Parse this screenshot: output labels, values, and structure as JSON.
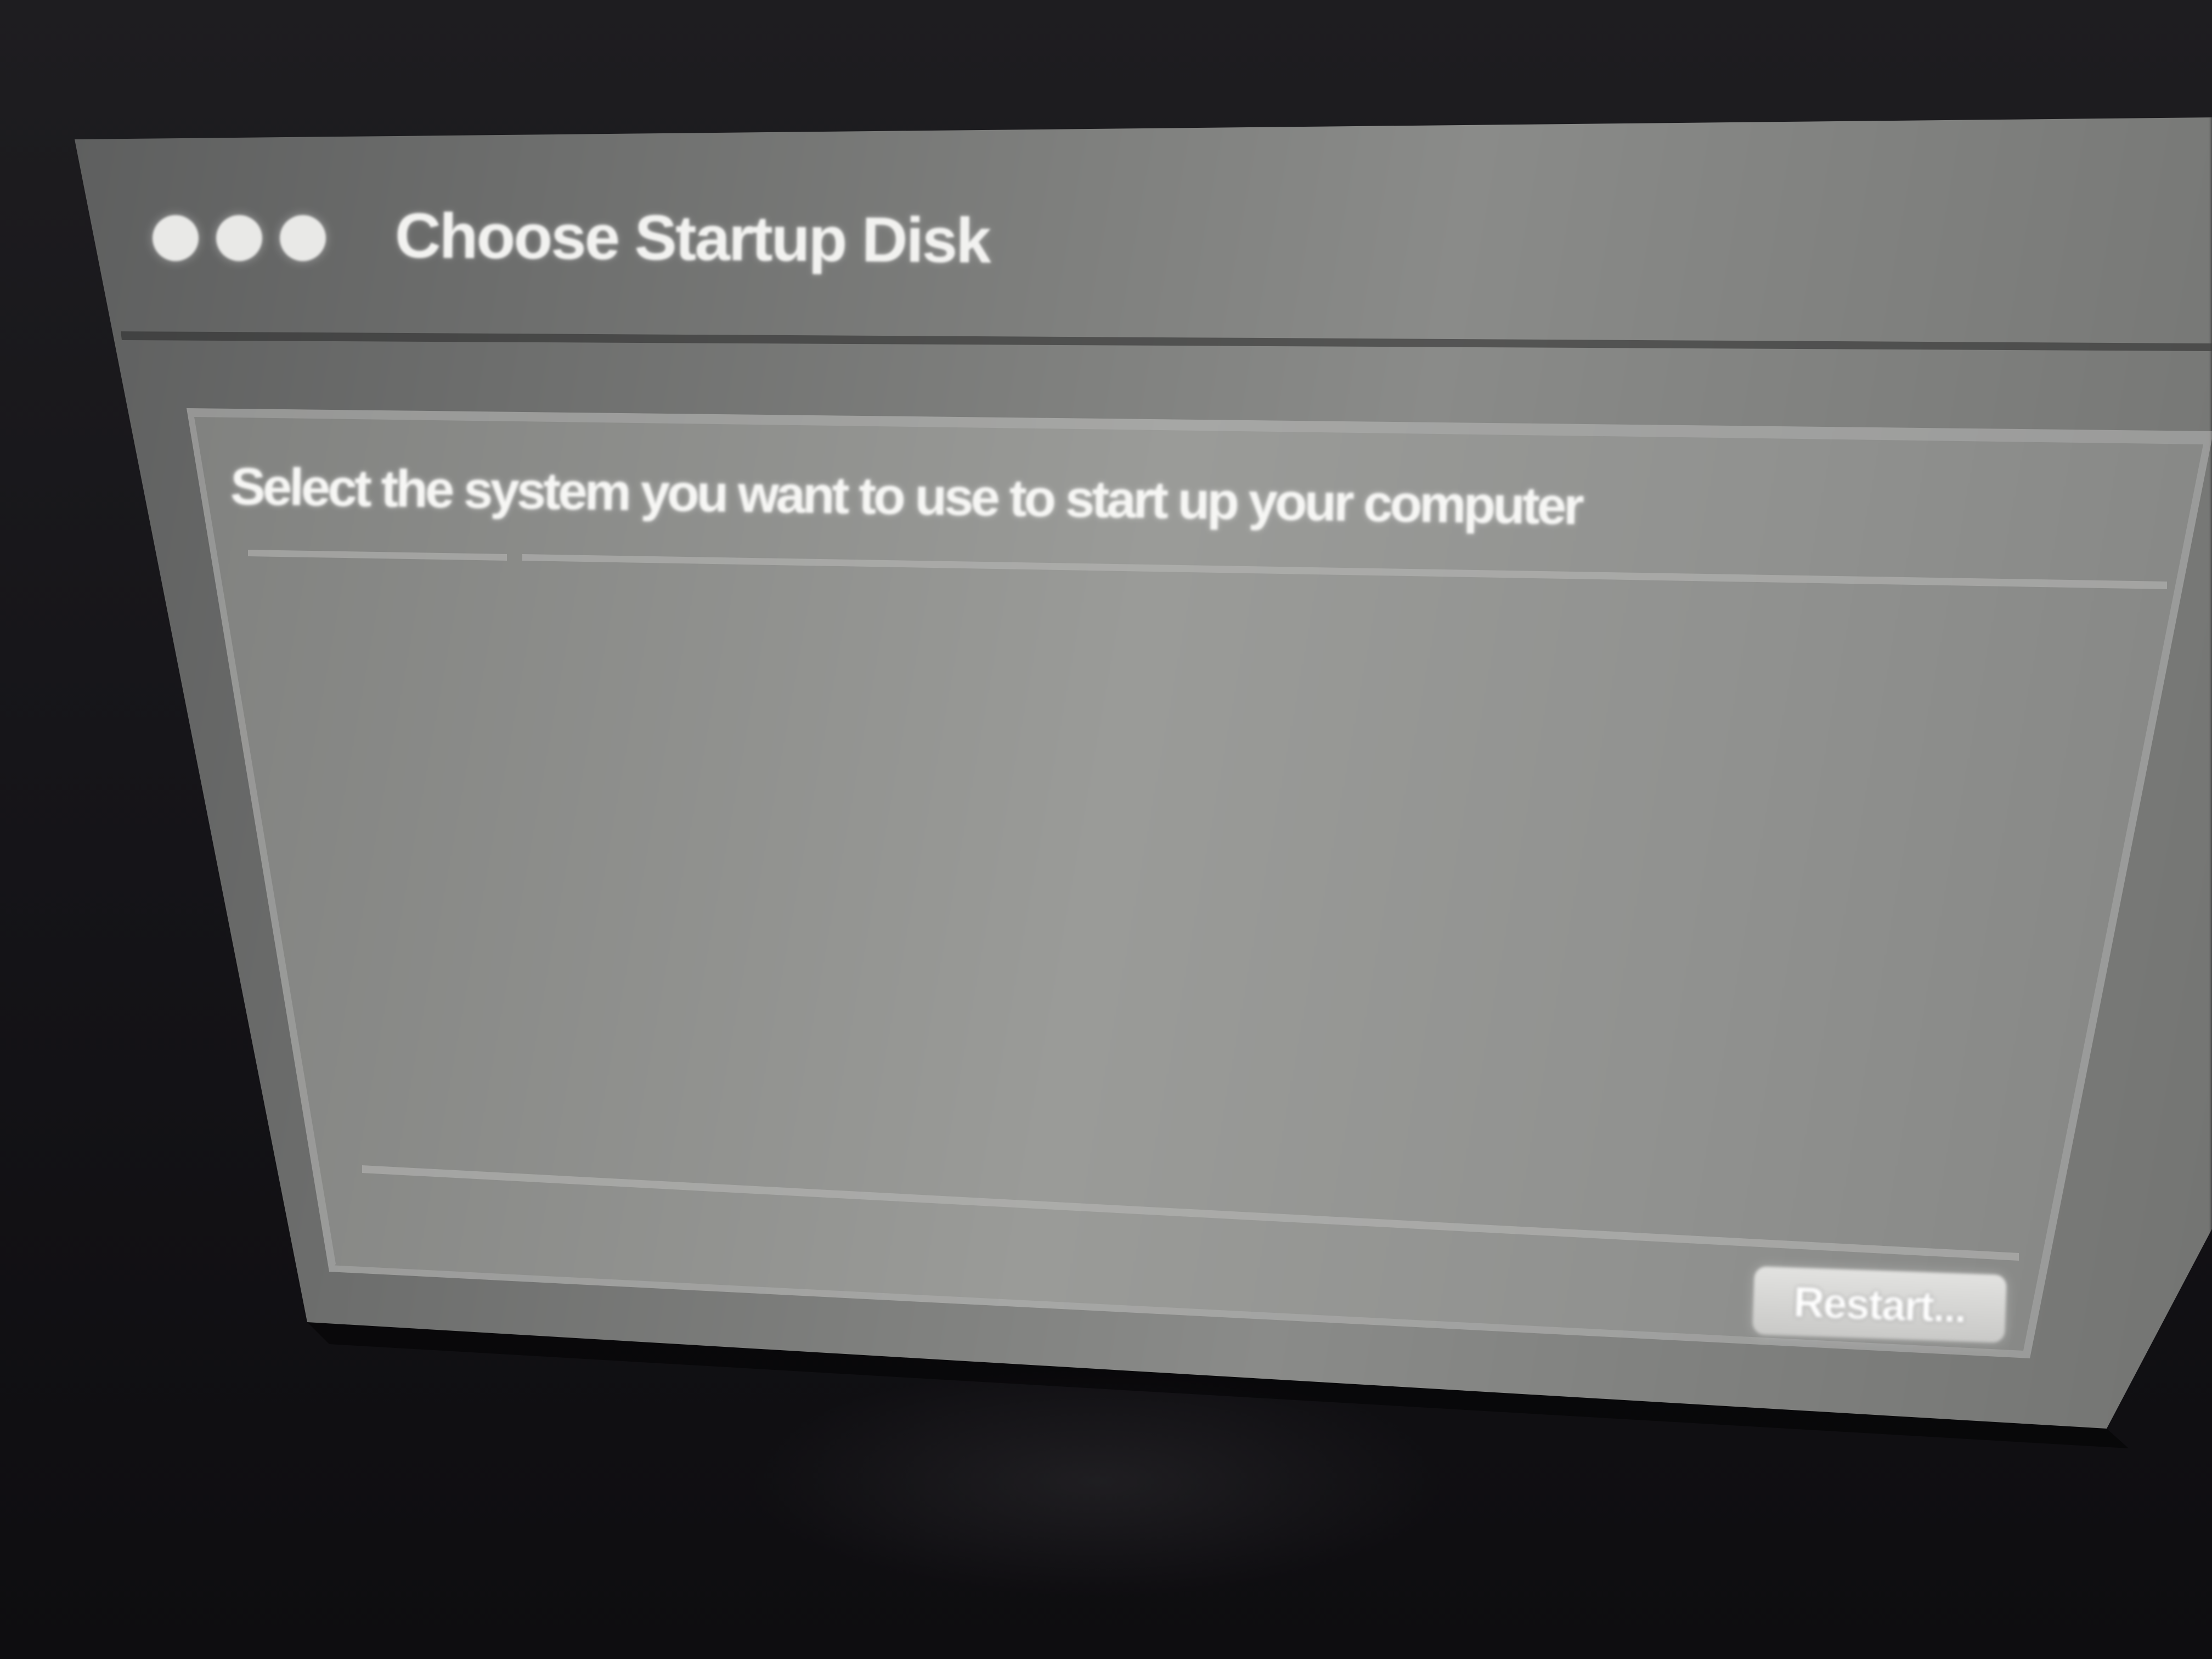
{
  "window": {
    "title": "Choose Startup Disk",
    "traffic_lights": [
      "close",
      "minimize",
      "zoom"
    ]
  },
  "main": {
    "instruction": "Select the system you want to use to start up your computer",
    "disks": []
  },
  "footer": {
    "restart_label": "Restart..."
  },
  "colors": {
    "window_bg": "#7f807e",
    "panel_bg": "#9a9b98",
    "text": "#f2f2f0",
    "desktop_bg": "#161519"
  }
}
